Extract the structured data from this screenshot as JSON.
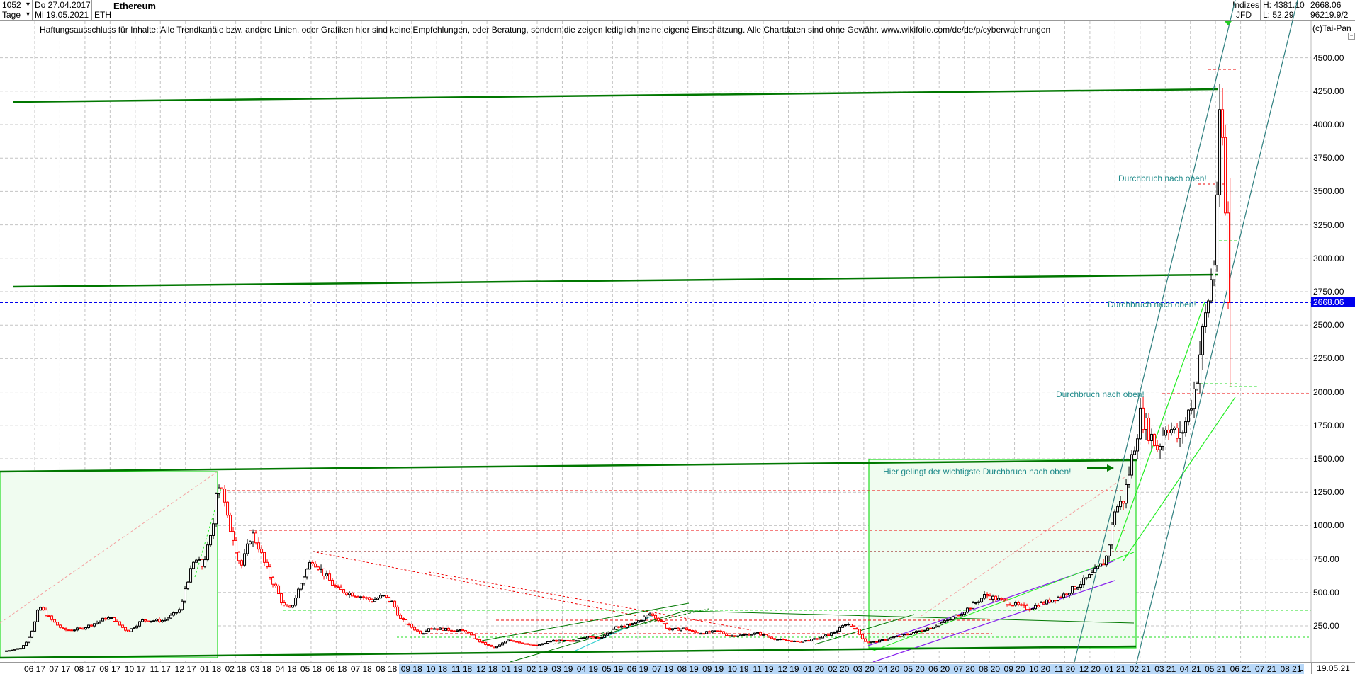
{
  "header": {
    "bars": "1052",
    "period": "Tage",
    "date_from": "Do 27.04.2017",
    "date_to": "Mi 19.05.2021",
    "symbol": "ETH",
    "title": "Ethereum",
    "exchange_group": "Indizes",
    "exchange": "JFD",
    "high": "H: 4381.10",
    "low": "L: 52.29",
    "last": "2668.06",
    "volume": "96219.9/2"
  },
  "disclaimer": "Haftungsausschluss für Inhalte: Alle Trendkanäle bzw. andere Linien, oder Grafiken hier sind keine Empfehlungen, oder Beratung, sondern die zeigen lediglich meine eigene Einschätzung. Alle Chartdaten sind ohne Gewähr.  www.wikifolio.com/de/de/p/cyberwaehrungen",
  "copyright": "(c)Tai-Pan",
  "annotations": {
    "main_breakout": "Hier gelingt der wichtigste Durchbruch nach oben!",
    "breakout_1": "Durchbruch nach oben!",
    "breakout_2": "Durchbruch nach oben!",
    "breakout_3": "Durchbruch nach oben!"
  },
  "footer": {
    "scale_mode": "L",
    "date": "19.05.21"
  },
  "colors": {
    "up": "#000000",
    "down": "#ff0000",
    "trend": "#007700",
    "current": "#0000ee",
    "channel": "#2f7f7f",
    "box": "#f0fcf0"
  },
  "chart_data": {
    "type": "candlestick",
    "title": "Ethereum",
    "x_unit": "months since 06.2017",
    "ylim": [
      0,
      4600
    ],
    "yticks": [
      "250.00",
      "500.00",
      "750.00",
      "1000.00",
      "1250.00",
      "1500.00",
      "1750.00",
      "2000.00",
      "2250.00",
      "2500.00",
      "2750.00",
      "3000.00",
      "3250.00",
      "3500.00",
      "3750.00",
      "4000.00",
      "4250.00",
      "4500.00"
    ],
    "ytick_values": [
      250,
      500,
      750,
      1000,
      1250,
      1500,
      1750,
      2000,
      2250,
      2500,
      2750,
      3000,
      3250,
      3500,
      3750,
      4000,
      4250,
      4500
    ],
    "current_value": 2668.06,
    "current_label": "2668.06",
    "xticks": [
      "06 17",
      "07 17",
      "08 17",
      "09 17",
      "10 17",
      "11 17",
      "12 17",
      "01 18",
      "02 18",
      "03 18",
      "04 18",
      "05 18",
      "06 18",
      "07 18",
      "08 18",
      "09 18",
      "10 18",
      "11 18",
      "12 18",
      "01 19",
      "02 19",
      "03 19",
      "04 19",
      "05 19",
      "06 19",
      "07 19",
      "08 19",
      "09 19",
      "10 19",
      "11 19",
      "12 19",
      "01 20",
      "02 20",
      "03 20",
      "04 20",
      "05 20",
      "06 20",
      "07 20",
      "08 20",
      "09 20",
      "10 20",
      "11 20",
      "12 20",
      "01 21",
      "02 21",
      "03 21",
      "04 21",
      "05 21",
      "06 21",
      "07 21",
      "08 21"
    ],
    "highlight_from_tick": 15,
    "price_path": [
      [
        -1.24,
        60
      ],
      [
        -0.54,
        85
      ],
      [
        0.17,
        400
      ],
      [
        0.59,
        310
      ],
      [
        1.16,
        220
      ],
      [
        1.44,
        220
      ],
      [
        1.86,
        230
      ],
      [
        2.85,
        310
      ],
      [
        3.13,
        300
      ],
      [
        3.7,
        210
      ],
      [
        4.26,
        290
      ],
      [
        5.11,
        290
      ],
      [
        5.53,
        335
      ],
      [
        5.81,
        380
      ],
      [
        6.01,
        560
      ],
      [
        6.38,
        750
      ],
      [
        6.66,
        700
      ],
      [
        7.08,
        960
      ],
      [
        7.22,
        1280
      ],
      [
        7.42,
        1330
      ],
      [
        7.64,
        1065
      ],
      [
        7.93,
        900
      ],
      [
        8.21,
        690
      ],
      [
        8.49,
        850
      ],
      [
        8.63,
        950
      ],
      [
        8.91,
        850
      ],
      [
        9.2,
        690
      ],
      [
        9.62,
        530
      ],
      [
        9.9,
        400
      ],
      [
        10.18,
        375
      ],
      [
        10.47,
        510
      ],
      [
        10.75,
        640
      ],
      [
        11.03,
        750
      ],
      [
        11.31,
        690
      ],
      [
        11.73,
        590
      ],
      [
        12.02,
        525
      ],
      [
        12.44,
        500
      ],
      [
        13.0,
        470
      ],
      [
        13.43,
        440
      ],
      [
        13.85,
        475
      ],
      [
        14.27,
        420
      ],
      [
        14.56,
        300
      ],
      [
        14.98,
        245
      ],
      [
        15.4,
        190
      ],
      [
        15.66,
        235
      ],
      [
        17.18,
        210
      ],
      [
        17.55,
        150
      ],
      [
        18.31,
        85
      ],
      [
        18.82,
        150
      ],
      [
        19.32,
        125
      ],
      [
        19.94,
        100
      ],
      [
        20.59,
        140
      ],
      [
        21.47,
        135
      ],
      [
        21.72,
        165
      ],
      [
        22.6,
        165
      ],
      [
        23.1,
        235
      ],
      [
        23.72,
        255
      ],
      [
        24.49,
        340
      ],
      [
        24.99,
        280
      ],
      [
        25.25,
        220
      ],
      [
        25.87,
        230
      ],
      [
        26.38,
        195
      ],
      [
        27.25,
        210
      ],
      [
        27.64,
        175
      ],
      [
        28.12,
        180
      ],
      [
        28.77,
        195
      ],
      [
        29.53,
        150
      ],
      [
        30.41,
        130
      ],
      [
        31.17,
        155
      ],
      [
        31.9,
        210
      ],
      [
        32.3,
        270
      ],
      [
        32.67,
        235
      ],
      [
        33.12,
        125
      ],
      [
        33.43,
        130
      ],
      [
        34.19,
        165
      ],
      [
        35.18,
        210
      ],
      [
        36.45,
        300
      ],
      [
        37.83,
        480
      ],
      [
        39.55,
        380
      ],
      [
        40.93,
        480
      ],
      [
        42.12,
        640
      ],
      [
        42.62,
        740
      ],
      [
        42.99,
        1120
      ],
      [
        43.33,
        1190
      ],
      [
        43.67,
        1510
      ],
      [
        44.01,
        1830
      ],
      [
        44.71,
        1575
      ],
      [
        45.05,
        1770
      ],
      [
        45.56,
        1640
      ],
      [
        45.9,
        1830
      ],
      [
        46.24,
        2090
      ],
      [
        46.41,
        2345
      ],
      [
        46.69,
        2670
      ],
      [
        46.95,
        2990
      ],
      [
        47.0,
        3380
      ],
      [
        47.11,
        3640
      ],
      [
        47.2,
        4160
      ],
      [
        47.31,
        3770
      ],
      [
        47.39,
        3320
      ],
      [
        47.58,
        2668.06
      ]
    ]
  }
}
